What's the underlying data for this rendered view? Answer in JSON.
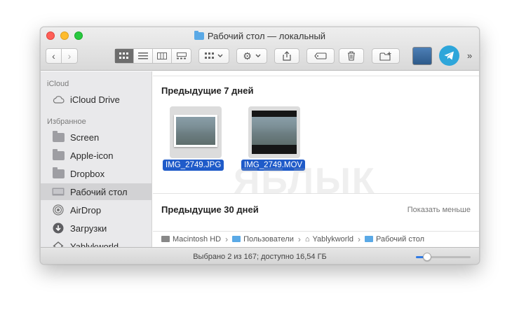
{
  "window": {
    "title": "Рабочий стол — локальный"
  },
  "toolbar": {
    "back_glyph": "‹",
    "forward_glyph": "›",
    "more_glyph": "»",
    "icons": [
      "icon-view-grid",
      "list-view-icon",
      "column-view-icon",
      "gallery-view-icon",
      "group-icon",
      "gear-icon",
      "share-icon",
      "tag-icon",
      "trash-icon",
      "new-folder-icon",
      "preview-app-icon",
      "telegram-icon"
    ]
  },
  "sidebar": {
    "icloud_header": "iCloud",
    "icloud_drive": "iCloud Drive",
    "favorites_header": "Избранное",
    "items": [
      {
        "label": "Screen"
      },
      {
        "label": "Apple-icon"
      },
      {
        "label": "Dropbox"
      },
      {
        "label": "Рабочий стол"
      },
      {
        "label": "AirDrop"
      },
      {
        "label": "Загрузки"
      },
      {
        "label": "Yablykworld"
      }
    ]
  },
  "content": {
    "section1_title": "Предыдущие 7 дней",
    "files": [
      {
        "name": "IMG_2749.JPG"
      },
      {
        "name": "IMG_2749.MOV"
      }
    ],
    "section2_title": "Предыдущие 30 дней",
    "show_less": "Показать меньше"
  },
  "pathbar": {
    "crumbs": [
      "Macintosh HD",
      "Пользователи",
      "Yablykworld",
      "Рабочий стол"
    ],
    "separator": "›"
  },
  "statusbar": {
    "text": "Выбрано 2 из 167; доступно 16,54 ГБ",
    "zoom_fraction": 0.2
  },
  "watermark": "ЯБЛЫК",
  "colors": {
    "selection": "#1f5bc9",
    "telegram": "#2ea6da",
    "slider": "#2f7ae5"
  }
}
